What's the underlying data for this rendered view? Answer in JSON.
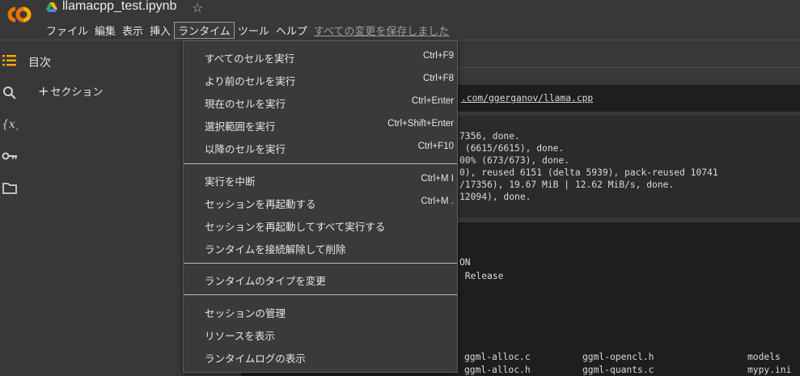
{
  "header": {
    "filename": "llamacpp_test.ipynb",
    "star": "☆",
    "menus": [
      "ファイル",
      "編集",
      "表示",
      "挿入",
      "ランタイム",
      "ツール",
      "ヘルプ"
    ],
    "save_status": "すべての変更を保存しました"
  },
  "toc": {
    "title": "目次",
    "add_section": "セクション",
    "plus": "+"
  },
  "icons": {
    "toc": "list-icon",
    "search": "search-icon",
    "variables": "variables-icon",
    "secrets": "key-icon",
    "files": "folder-icon"
  },
  "output": {
    "cell_a": ".com/ggerganov/llama.cpp",
    "cell_b": [
      "7356, done.",
      " (6615/6615), done.",
      "00% (673/673), done.",
      "0), reused 6151 (delta 5939), pack-reused 10741",
      "/17356), 19.67 MiB | 12.62 MiB/s, done.",
      "12094), done."
    ],
    "cell_c": [
      "ON",
      " Release"
    ],
    "cell_d": [
      [
        "ggml-alloc.c",
        "ggml-opencl.h",
        "models"
      ],
      [
        "ggml-alloc.h",
        "ggml-quants.c",
        "mypy.ini"
      ]
    ]
  },
  "runtime_menu": {
    "groups": [
      [
        {
          "label": "すべてのセルを実行",
          "shortcut": "Ctrl+F9"
        },
        {
          "label": "より前のセルを実行",
          "shortcut": "Ctrl+F8"
        },
        {
          "label": "現在のセルを実行",
          "shortcut": "Ctrl+Enter"
        },
        {
          "label": "選択範囲を実行",
          "shortcut": "Ctrl+Shift+Enter"
        },
        {
          "label": "以降のセルを実行",
          "shortcut": "Ctrl+F10"
        }
      ],
      [
        {
          "label": "実行を中断",
          "shortcut": "Ctrl+M I"
        },
        {
          "label": "セッションを再起動する",
          "shortcut": "Ctrl+M ."
        },
        {
          "label": "セッションを再起動してすべて実行する",
          "shortcut": ""
        },
        {
          "label": "ランタイムを接続解除して削除",
          "shortcut": ""
        }
      ],
      [
        {
          "label": "ランタイムのタイプを変更",
          "shortcut": ""
        }
      ],
      [
        {
          "label": "セッションの管理",
          "shortcut": ""
        },
        {
          "label": "リソースを表示",
          "shortcut": ""
        },
        {
          "label": "ランタイムログの表示",
          "shortcut": ""
        }
      ]
    ]
  },
  "colors": {
    "background": "#383838",
    "output_bg": "#1e1e1e",
    "menu_bg": "#3a3a3a",
    "logo_orange": "#f9ab00",
    "logo_dark_orange": "#e8710a"
  }
}
